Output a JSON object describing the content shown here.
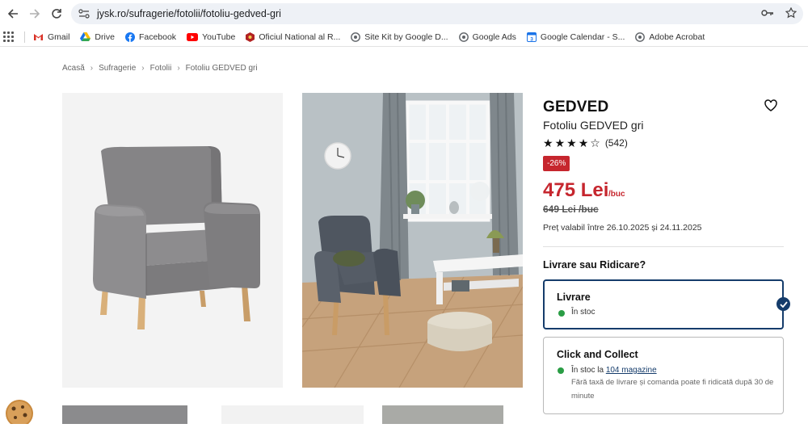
{
  "browser": {
    "url": "jysk.ro/sufragerie/fotolii/fotoliu-gedved-gri",
    "bookmarks": [
      {
        "label": "Gmail",
        "color": "#d93025"
      },
      {
        "label": "Drive",
        "color": "#1a73e8"
      },
      {
        "label": "Facebook",
        "color": "#1877f2"
      },
      {
        "label": "YouTube",
        "color": "#ff0000"
      },
      {
        "label": "Oficiul National al R...",
        "color": "#b22222"
      },
      {
        "label": "Site Kit by Google D...",
        "color": "#5f6368"
      },
      {
        "label": "Google Ads",
        "color": "#5f6368"
      },
      {
        "label": "Google Calendar - S...",
        "color": "#1a73e8"
      },
      {
        "label": "Adobe Acrobat",
        "color": "#5f6368"
      }
    ]
  },
  "breadcrumb": [
    "Acasă",
    "Sufragerie",
    "Fotolii",
    "Fotoliu GEDVED gri"
  ],
  "product": {
    "brand": "GEDVED",
    "name": "Fotoliu GEDVED gri",
    "rating_stars": 4,
    "rating_count": "(542)",
    "discount": "-26%",
    "price": "475 Lei",
    "price_unit": "/buc",
    "old_price": "649 Lei /buc",
    "validity": "Preț valabil între 26.10.2025 și 24.11.2025"
  },
  "delivery": {
    "title": "Livrare sau Ridicare?",
    "options": [
      {
        "title": "Livrare",
        "status": "În stoc"
      },
      {
        "title": "Click and Collect",
        "status_prefix": "În stoc la ",
        "status_link": "104 magazine",
        "note": "Fără taxă de livrare și comanda poate fi ridicată după 30 de minute"
      }
    ]
  },
  "colors": {
    "accent": "#153c6b",
    "price": "#c6262e",
    "in_stock": "#2a9d45"
  }
}
